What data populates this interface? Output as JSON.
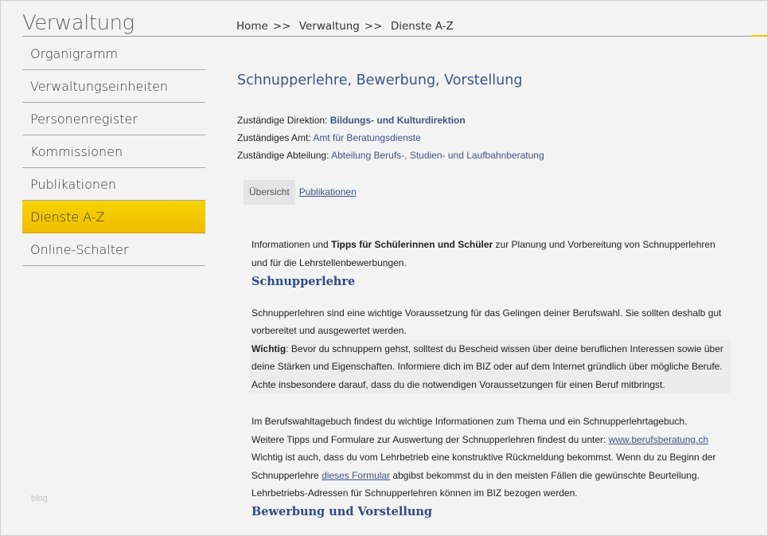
{
  "site": {
    "title": "Verwaltung"
  },
  "breadcrumb": {
    "items": [
      "Home",
      "Verwaltung",
      "Dienste A-Z"
    ],
    "separator": ">>"
  },
  "sidebar": {
    "items": [
      {
        "label": "Organigramm",
        "active": false
      },
      {
        "label": "Verwaltungseinheiten",
        "active": false
      },
      {
        "label": "Personenregister",
        "active": false
      },
      {
        "label": "Kommissionen",
        "active": false
      },
      {
        "label": "Publikationen",
        "active": false
      },
      {
        "label": "Dienste A-Z",
        "active": true
      },
      {
        "label": "Online-Schalter",
        "active": false
      }
    ],
    "footer_text": "blog"
  },
  "main": {
    "title": "Schnupperlehre, Bewerbung, Vorstellung",
    "info": {
      "direktion_label": "Zuständige Direktion:",
      "direktion_value": "Bildungs- und Kulturdirektion",
      "amt_label": "Zuständiges Amt:",
      "amt_value": "Amt für Beratungsdienste",
      "abteilung_label": "Zuständige Abteilung:",
      "abteilung_value": "Abteilung Berufs-, Studien- und Laufbahnberatung"
    },
    "tabs": [
      {
        "label": "Übersicht",
        "active": true
      },
      {
        "label": "Publikationen",
        "active": false
      }
    ],
    "intro": {
      "pre": "Informationen und ",
      "bold": "Tipps für Schülerinnen und Schüler",
      "post": " zur Planung und Vorbereitung von Schnupperlehren und für die Lehrstellenbewerbungen."
    },
    "section1": {
      "heading": "Schnupperlehre",
      "para1": "Schnupperlehren sind eine wichtige Voraussetzung für das Gelingen deiner Berufswahl. Sie sollten deshalb gut vorbereitet und ausgewertet werden.",
      "note_label": "Wichtig",
      "note_text": ": Bevor du schnuppern gehst, solltest du Bescheid wissen über deine beruflichen Interessen sowie über deine Stärken und Eigenschaften. Informiere dich im BIZ oder auf dem Internet gründlich über mögliche Berufe. Achte insbesondere darauf, dass du die notwendigen Voraussetzungen für einen Beruf mitbringst.",
      "para2_line1": "Im Berufswahltagebuch findest du wichtige Informationen zum Thema und ein Schnupperlehrtagebuch.",
      "para2_line2_pre": "Weitere Tipps und Formulare zur Auswertung der Schnupperlehren findest du unter: ",
      "para2_link": "www.berufsberatung.ch",
      "para3_pre": "Wichtig ist auch, dass du vom Lehrbetrieb eine konstruktive Rückmeldung bekommst. Wenn du zu Beginn der Schnupperlehre ",
      "para3_link": "dieses Formular",
      "para3_post": " abgibst bekommst du in den meisten Fällen die gewünschte Beurteilung.",
      "para4": "Lehrbetriebs-Adressen für Schnupperlehren können im BIZ bezogen werden."
    },
    "section2": {
      "heading": "Bewerbung und Vorstellung"
    }
  },
  "colors": {
    "accent": "#f3c600",
    "link": "#3c5586",
    "heading": "#2e4b86"
  }
}
